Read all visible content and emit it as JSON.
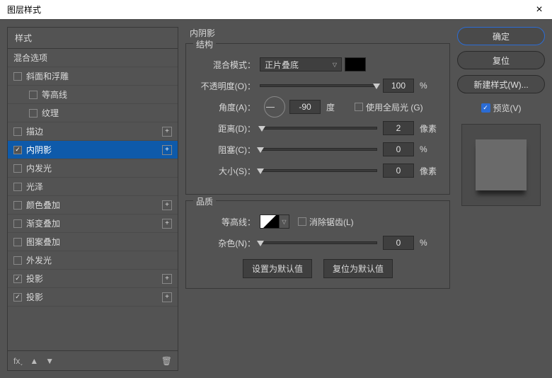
{
  "window": {
    "title": "图层样式",
    "close": "×"
  },
  "sidebar": {
    "header": "样式",
    "items": [
      {
        "label": "混合选项",
        "hasCheck": false
      },
      {
        "label": "斜面和浮雕",
        "hasCheck": true,
        "checked": false
      },
      {
        "label": "等高线",
        "hasCheck": true,
        "checked": false,
        "indent": true
      },
      {
        "label": "纹理",
        "hasCheck": true,
        "checked": false,
        "indent": true
      },
      {
        "label": "描边",
        "hasCheck": true,
        "checked": false,
        "plus": true
      },
      {
        "label": "内阴影",
        "hasCheck": true,
        "checked": true,
        "plus": true,
        "selected": true
      },
      {
        "label": "内发光",
        "hasCheck": true,
        "checked": false
      },
      {
        "label": "光泽",
        "hasCheck": true,
        "checked": false
      },
      {
        "label": "颜色叠加",
        "hasCheck": true,
        "checked": false,
        "plus": true
      },
      {
        "label": "渐变叠加",
        "hasCheck": true,
        "checked": false,
        "plus": true
      },
      {
        "label": "图案叠加",
        "hasCheck": true,
        "checked": false
      },
      {
        "label": "外发光",
        "hasCheck": true,
        "checked": false
      },
      {
        "label": "投影",
        "hasCheck": true,
        "checked": true,
        "plus": true
      },
      {
        "label": "投影",
        "hasCheck": true,
        "checked": true,
        "plus": true
      }
    ]
  },
  "center": {
    "title": "内阴影",
    "structure": {
      "title": "结构",
      "blendModeLabel": "混合模式：",
      "blendModeValue": "正片叠底",
      "opacityLabel": "不透明度(O)：",
      "opacityValue": "100",
      "percent": "%",
      "angleLabel": "角度(A)：",
      "angleValue": "-90",
      "degree": "度",
      "globalLightLabel": "使用全局光 (G)",
      "distanceLabel": "距离(D)：",
      "distanceValue": "2",
      "pixel": "像素",
      "chokeLabel": "阻塞(C)：",
      "chokeValue": "0",
      "sizeLabel": "大小(S)：",
      "sizeValue": "0"
    },
    "quality": {
      "title": "品质",
      "contourLabel": "等高线：",
      "antiAliasLabel": "消除锯齿(L)",
      "noiseLabel": "杂色(N)：",
      "noiseValue": "0"
    },
    "makeDefault": "设置为默认值",
    "resetDefault": "复位为默认值"
  },
  "right": {
    "ok": "确定",
    "reset": "复位",
    "newStyle": "新建样式(W)...",
    "preview": "预览(V)"
  }
}
